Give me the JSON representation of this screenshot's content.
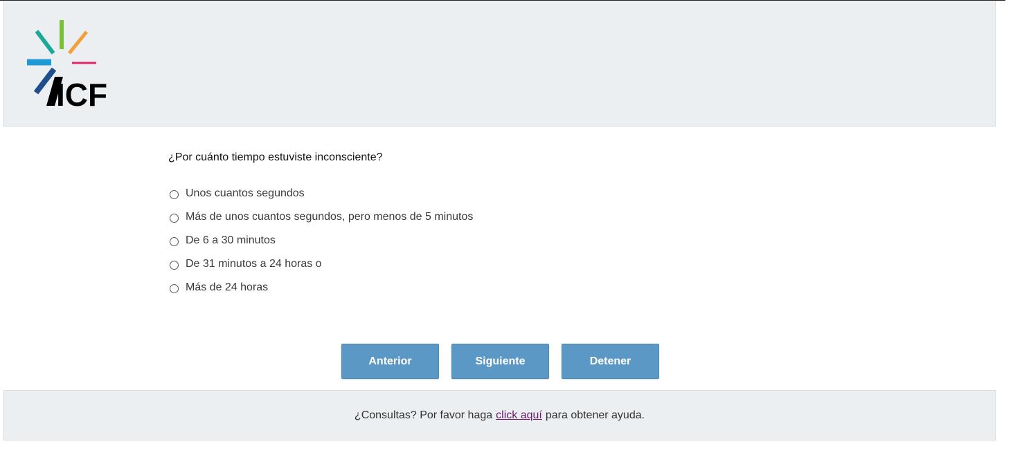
{
  "header": {
    "logo_text": "ICF",
    "logo_colors": {
      "teal": "#1aa89a",
      "green": "#7bbf3a",
      "orange": "#f2a03a",
      "blue": "#1e9bd7",
      "magenta": "#e0246e",
      "navy": "#1f4e8c",
      "black": "#000000"
    }
  },
  "question": {
    "text": "¿Por cuánto tiempo estuviste inconsciente?",
    "options": [
      {
        "label": "Unos cuantos segundos",
        "selected": false
      },
      {
        "label": "Más de unos cuantos segundos, pero menos de 5 minutos",
        "selected": false
      },
      {
        "label": "De 6 a 30 minutos",
        "selected": false
      },
      {
        "label": "De 31 minutos a 24 horas o",
        "selected": false
      },
      {
        "label": "Más de 24 horas",
        "selected": false
      }
    ]
  },
  "nav": {
    "previous_label": "Anterior",
    "next_label": "Siguiente",
    "stop_label": "Detener",
    "button_color": "#5b98c6"
  },
  "footer": {
    "prefix": "¿Consultas? Por favor haga",
    "link_text": "click aquí",
    "suffix": "para obtener ayuda.",
    "link_color": "#6b1a6b"
  }
}
